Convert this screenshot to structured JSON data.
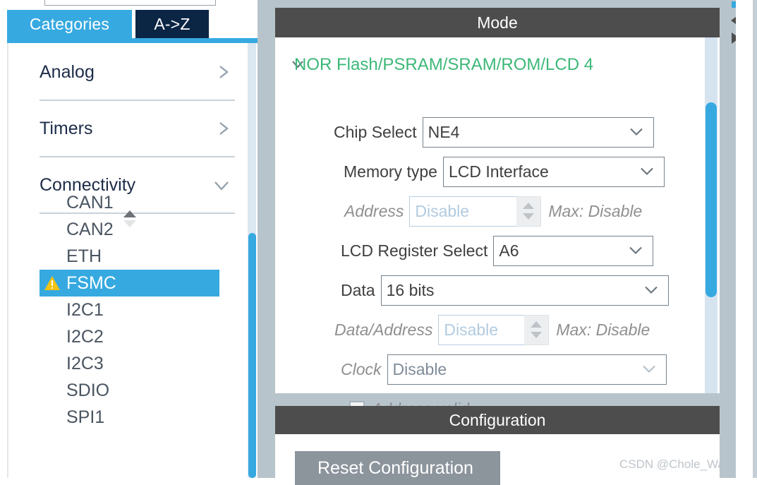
{
  "search": {
    "value": "",
    "placeholder": ""
  },
  "tabs": [
    {
      "label": "Categories",
      "selected": true
    },
    {
      "label": "A->Z",
      "selected": false
    }
  ],
  "categories": [
    {
      "label": "Analog",
      "expanded": false,
      "icon": "chevron-right-icon"
    },
    {
      "label": "Timers",
      "expanded": false,
      "icon": "chevron-right-icon"
    },
    {
      "label": "Connectivity",
      "expanded": true,
      "icon": "chevron-down-icon"
    }
  ],
  "peripherals": [
    {
      "label": "CAN1",
      "selected": false,
      "warning": false
    },
    {
      "label": "CAN2",
      "selected": false,
      "warning": false
    },
    {
      "label": "ETH",
      "selected": false,
      "warning": false
    },
    {
      "label": "FSMC",
      "selected": true,
      "warning": true
    },
    {
      "label": "I2C1",
      "selected": false,
      "warning": false
    },
    {
      "label": "I2C2",
      "selected": false,
      "warning": false
    },
    {
      "label": "I2C3",
      "selected": false,
      "warning": false
    },
    {
      "label": "SDIO",
      "selected": false,
      "warning": false
    },
    {
      "label": "SPI1",
      "selected": false,
      "warning": false
    }
  ],
  "mode": {
    "header": "Mode",
    "group_title": "NOR Flash/PSRAM/SRAM/ROM/LCD 4",
    "fields": {
      "chip_select": {
        "label": "Chip Select",
        "value": "NE4",
        "disabled": false
      },
      "memory_type": {
        "label": "Memory type",
        "value": "LCD Interface",
        "disabled": false
      },
      "address": {
        "label": "Address",
        "value": "Disable",
        "max": "Max: Disable",
        "disabled": true
      },
      "lcd_register_select": {
        "label": "LCD Register Select",
        "value": "A6",
        "disabled": false
      },
      "data": {
        "label": "Data",
        "value": "16 bits",
        "disabled": false
      },
      "data_address": {
        "label": "Data/Address",
        "value": "Disable",
        "max": "Max: Disable",
        "disabled": true
      },
      "clock": {
        "label": "Clock",
        "value": "Disable",
        "disabled": true
      },
      "address_valid": {
        "label": "Address valid",
        "checked": false,
        "disabled": true
      }
    }
  },
  "configuration": {
    "header": "Configuration",
    "reset_button": "Reset Configuration"
  },
  "watermark": "CSDN @Chole_Waston",
  "colors": {
    "accent_blue": "#36a9e1",
    "tab_dark": "#0b2545",
    "header_gray": "#4d4d4d",
    "group_green": "#3cb878",
    "warning_yellow": "#f2c314",
    "panel_border": "#b8c4cc",
    "button_gray": "#8c949c"
  }
}
